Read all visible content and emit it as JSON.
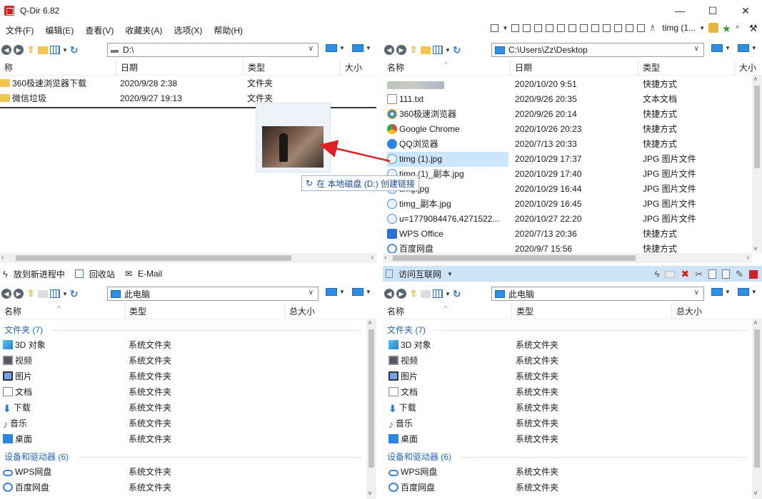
{
  "window": {
    "title": "Q-Dir 6.82",
    "controls": {
      "minimize": "—",
      "maximize": "☐",
      "close": "✕"
    }
  },
  "menu": {
    "items": [
      "文件(F)",
      "编辑(E)",
      "查看(V)",
      "收藏夹(A)",
      "选项(X)",
      "帮助(H)"
    ],
    "user_label": "timg (1..."
  },
  "pane_tl": {
    "address": "D:\\",
    "columns": [
      "称",
      "日期",
      "类型",
      "大小"
    ],
    "rows": [
      {
        "name": "360极速浏览器下载",
        "date": "2020/9/28 2:38",
        "type": "文件夹"
      },
      {
        "name": "微信垃圾",
        "date": "2020/9/27 19:13",
        "type": "文件夹"
      }
    ]
  },
  "pane_tr": {
    "address": "C:\\Users\\Zz\\Desktop",
    "columns": [
      "名称",
      "日期",
      "类型",
      "大小"
    ],
    "rows": [
      {
        "name": "",
        "date": "2020/10/20 9:51",
        "type": "快捷方式",
        "icon": "blurred"
      },
      {
        "name": "111.txt",
        "date": "2020/9/26 20:35",
        "type": "文本文档",
        "icon": "txt"
      },
      {
        "name": "360极速浏览器",
        "date": "2020/9/26 20:14",
        "type": "快捷方式",
        "icon": "360"
      },
      {
        "name": "Google Chrome",
        "date": "2020/10/26 20:23",
        "type": "快捷方式",
        "icon": "chrome"
      },
      {
        "name": "QQ浏览器",
        "date": "2020/7/13 20:33",
        "type": "快捷方式",
        "icon": "qq"
      },
      {
        "name": "timg (1).jpg",
        "date": "2020/10/29 17:37",
        "type": "JPG 图片文件",
        "icon": "jpg"
      },
      {
        "name": "timg (1)_副本.jpg",
        "date": "2020/10/29 17:40",
        "type": "JPG 图片文件",
        "icon": "jpg"
      },
      {
        "name": "timg.jpg",
        "date": "2020/10/29 16:44",
        "type": "JPG 图片文件",
        "icon": "jpg"
      },
      {
        "name": "timg_副本.jpg",
        "date": "2020/10/29 16:45",
        "type": "JPG 图片文件",
        "icon": "jpg"
      },
      {
        "name": "u=1779084476,4271522...",
        "date": "2020/10/27 22:20",
        "type": "JPG 图片文件",
        "icon": "jpg"
      },
      {
        "name": "WPS Office",
        "date": "2020/7/13 20:36",
        "type": "快捷方式",
        "icon": "wps"
      },
      {
        "name": "百度网盘",
        "date": "2020/9/7 15:56",
        "type": "快捷方式",
        "icon": "baidu"
      }
    ]
  },
  "status_left": {
    "new_process": "放到新进程中",
    "recycle": "回收站",
    "email": "E-Mail"
  },
  "status_right": {
    "visit_internet": "访问互联网"
  },
  "drag": {
    "tooltip": "在 本地磁盘 (D:) 创建链接"
  },
  "pane_bl": {
    "address": "此电脑",
    "columns": [
      "名称",
      "类型",
      "总大小"
    ],
    "group_folders": "文件夹 (7)",
    "group_devices": "设备和驱动器 (6)",
    "folders": [
      {
        "name": "3D 对象",
        "type": "系统文件夹",
        "icon": "3d"
      },
      {
        "name": "视频",
        "type": "系统文件夹",
        "icon": "video"
      },
      {
        "name": "图片",
        "type": "系统文件夹",
        "icon": "pic"
      },
      {
        "name": "文档",
        "type": "系统文件夹",
        "icon": "doc"
      },
      {
        "name": "下载",
        "type": "系统文件夹",
        "icon": "down"
      },
      {
        "name": "音乐",
        "type": "系统文件夹",
        "icon": "music"
      },
      {
        "name": "桌面",
        "type": "系统文件夹",
        "icon": "desk"
      }
    ],
    "devices": [
      {
        "name": "WPS网盘",
        "type": "系统文件夹",
        "icon": "cloud"
      },
      {
        "name": "百度网盘",
        "type": "系统文件夹",
        "icon": "baidu"
      }
    ]
  },
  "pane_br": {
    "address": "此电脑",
    "columns": [
      "名称",
      "类型",
      "总大小"
    ],
    "group_folders": "文件夹 (7)",
    "group_devices": "设备和驱动器 (6)",
    "folders": [
      {
        "name": "3D 对象",
        "type": "系统文件夹",
        "icon": "3d"
      },
      {
        "name": "视频",
        "type": "系统文件夹",
        "icon": "video"
      },
      {
        "name": "图片",
        "type": "系统文件夹",
        "icon": "pic"
      },
      {
        "name": "文档",
        "type": "系统文件夹",
        "icon": "doc"
      },
      {
        "name": "下载",
        "type": "系统文件夹",
        "icon": "down"
      },
      {
        "name": "音乐",
        "type": "系统文件夹",
        "icon": "music"
      },
      {
        "name": "桌面",
        "type": "系统文件夹",
        "icon": "desk"
      }
    ],
    "devices": [
      {
        "name": "WPS网盘",
        "type": "系统文件夹",
        "icon": "cloud"
      },
      {
        "name": "百度网盘",
        "type": "系统文件夹",
        "icon": "baidu"
      }
    ]
  },
  "colors": {
    "group_header": "#2a64b8",
    "status_blue": "#cfe3f6",
    "selection": "#cce6fb",
    "arrow": "#e02020"
  }
}
